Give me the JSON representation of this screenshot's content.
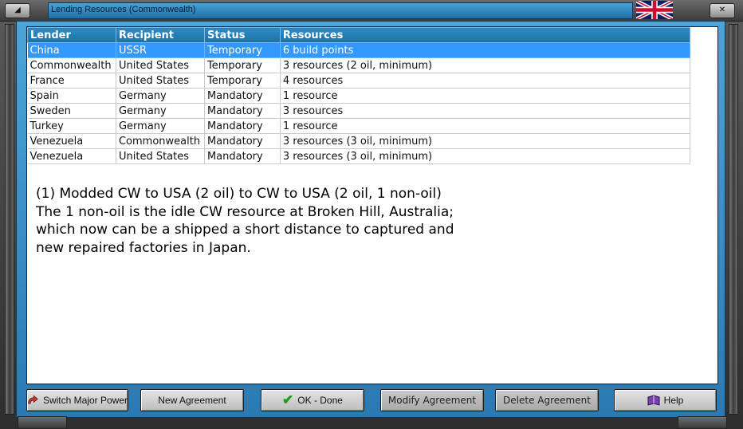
{
  "window": {
    "title": "Lending Resources (Commonwealth)",
    "flag_icon": "union-jack-flag-icon"
  },
  "table": {
    "columns": [
      "Lender",
      "Recipient",
      "Status",
      "Resources"
    ],
    "rows": [
      {
        "lender": "China",
        "recipient": "USSR",
        "status": "Temporary",
        "resources": "6 build points",
        "selected": true
      },
      {
        "lender": "Commonwealth",
        "recipient": "United States",
        "status": "Temporary",
        "resources": "3 resources (2 oil, minimum)"
      },
      {
        "lender": "France",
        "recipient": "United States",
        "status": "Temporary",
        "resources": "4 resources"
      },
      {
        "lender": "Spain",
        "recipient": "Germany",
        "status": "Mandatory",
        "resources": "1 resource"
      },
      {
        "lender": "Sweden",
        "recipient": "Germany",
        "status": "Mandatory",
        "resources": "3 resources"
      },
      {
        "lender": "Turkey",
        "recipient": "Germany",
        "status": "Mandatory",
        "resources": "1 resource"
      },
      {
        "lender": "Venezuela",
        "recipient": "Commonwealth",
        "status": "Mandatory",
        "resources": "3 resources (3 oil, minimum)"
      },
      {
        "lender": "Venezuela",
        "recipient": "United States",
        "status": "Mandatory",
        "resources": "3 resources (3 oil, minimum)"
      }
    ]
  },
  "note": {
    "lines": [
      "(1)  Modded CW to USA (2 oil) to CW to USA (2 oil, 1 non-oil)",
      "The 1 non-oil is the idle CW resource at Broken Hill, Australia;",
      "which now can be a shipped a short distance to captured and",
      "new repaired factories in Japan."
    ]
  },
  "buttons": {
    "switch_major_power": "Switch Major Power",
    "new_agreement": "New Agreement",
    "ok_done": "OK - Done",
    "modify_agreement": "Modify Agreement",
    "delete_agreement": "Delete Agreement",
    "help": "Help"
  },
  "colors": {
    "selection": "#3399ff",
    "frame_blue": "#3a8fc6",
    "header_blue": "#2a8ccb"
  }
}
